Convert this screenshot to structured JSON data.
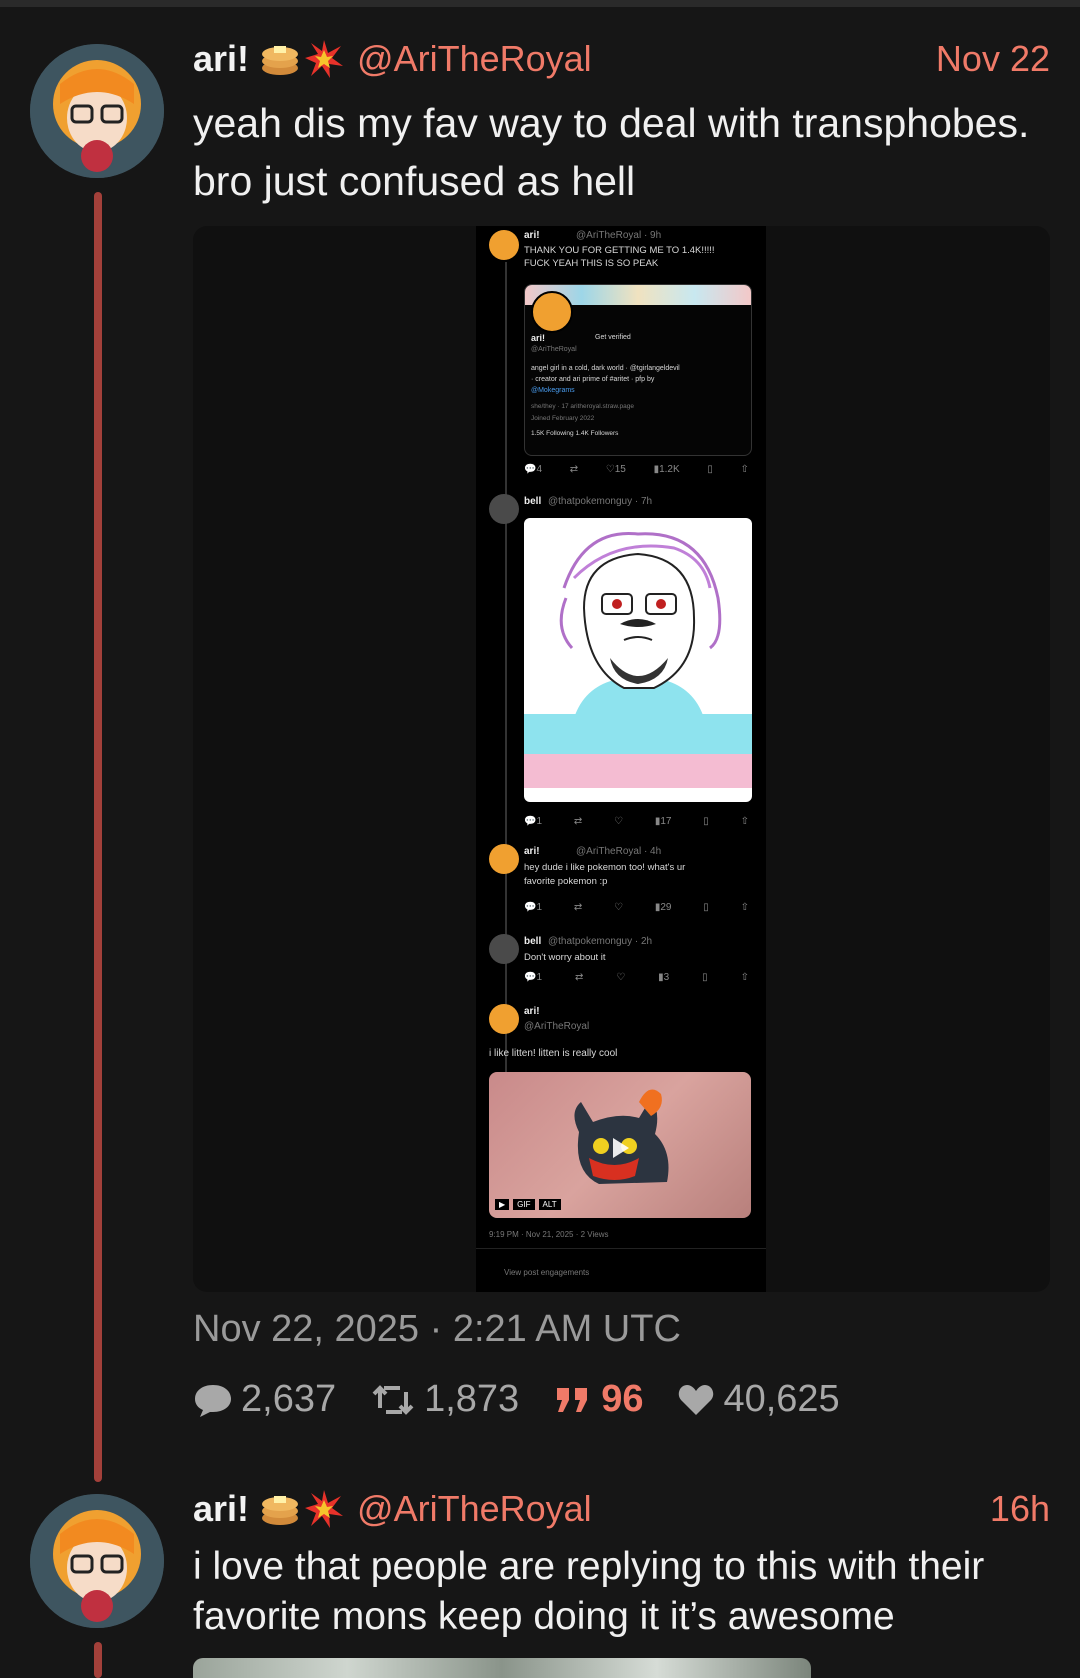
{
  "posts": [
    {
      "display_name": "ari!",
      "emojis": [
        "pancakes-emoji",
        "collision-emoji"
      ],
      "handle": "@AriTheRoyal",
      "time": "Nov 22",
      "text": "yeah dis my fav way to deal with transphobes. bro just confused as hell",
      "embedded_screenshot": {
        "tweet1": {
          "name": "ari!",
          "handle_time": "@AriTheRoyal · 9h",
          "text_line1": "THANK YOU FOR GETTING ME TO 1.4K!!!!!",
          "text_line2": "FUCK YEAH THIS IS SO PEAK",
          "card": {
            "name": "ari!",
            "verified": "Get verified",
            "handle": "@AriTheRoyal",
            "bio_line1": "angel girl in a cold, dark world · @tgirlangeldevil",
            "bio_line2": "· creator and ari prime of #aritet · pfp by",
            "bio_line3": "@Mokegrams",
            "meta": "she/they · 17   aritheroyal.straw.page",
            "joined": "Joined February 2022",
            "follows": "1.5K Following  1.4K Followers"
          },
          "actions": [
            "4",
            "",
            "15",
            "1.2K",
            "",
            ""
          ]
        },
        "tweet2": {
          "name": "bell",
          "handle_time": "@thatpokemonguy · 7h",
          "actions": [
            "1",
            "",
            "",
            "17",
            "",
            ""
          ]
        },
        "tweet3": {
          "name": "ari!",
          "handle_time": "@AriTheRoyal · 4h",
          "text_line1": "hey dude i like pokemon too! what's ur",
          "text_line2": "favorite pokemon :p",
          "actions": [
            "1",
            "",
            "",
            "29",
            "",
            ""
          ]
        },
        "tweet4": {
          "name": "bell",
          "handle_time": "@thatpokemonguy · 2h",
          "text": "Don't worry about it",
          "actions": [
            "1",
            "",
            "",
            "3",
            "",
            ""
          ]
        },
        "tweet5": {
          "name": "ari!",
          "handle": "@AriTheRoyal",
          "text": "i like litten! litten is really cool",
          "gif_badge": "GIF",
          "alt_badge": "ALT",
          "timestamp": "9:19 PM · Nov 21, 2025 · 2 Views",
          "engagements": "View post engagements"
        }
      },
      "full_date": "Nov 22, 2025 · 2:21 AM UTC",
      "stats": {
        "replies": "2,637",
        "reposts": "1,873",
        "quotes": "96",
        "likes": "40,625"
      }
    },
    {
      "display_name": "ari!",
      "emojis": [
        "pancakes-emoji",
        "collision-emoji"
      ],
      "handle": "@AriTheRoyal",
      "time": "16h",
      "text": "i love that people are replying to this with their favorite mons keep doing it it’s awesome"
    }
  ],
  "colors": {
    "background": "#161616",
    "accent": "#f07a68",
    "thread_line": "#a3403a",
    "muted": "#a8a8a8"
  }
}
